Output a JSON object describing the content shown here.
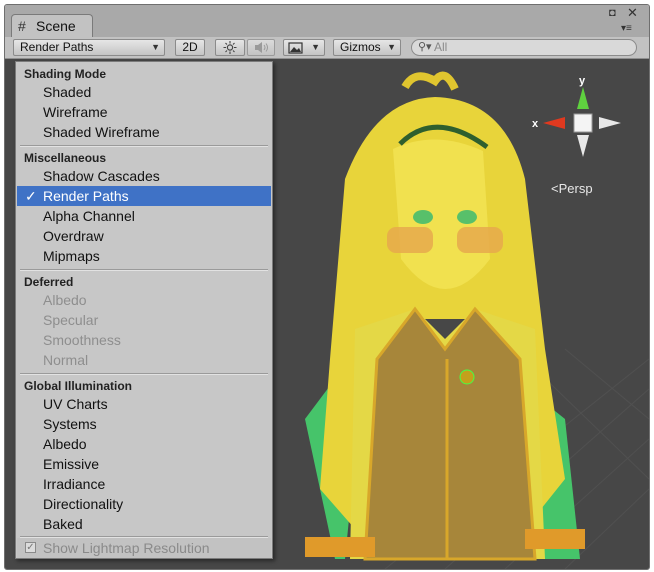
{
  "tab": {
    "icon": "scene-icon",
    "title": "Scene"
  },
  "toolbar": {
    "render_mode": "Render Paths",
    "mode_2d": "2D",
    "lighting_icon": "sun-icon",
    "audio_icon": "speaker-icon",
    "effects_icon": "image-icon",
    "gizmos": "Gizmos",
    "search_placeholder": "All"
  },
  "gizmo": {
    "y_label": "y",
    "x_label": "x",
    "projection": "Persp"
  },
  "menu": {
    "shading_header": "Shading Mode",
    "shading_items": [
      "Shaded",
      "Wireframe",
      "Shaded Wireframe"
    ],
    "misc_header": "Miscellaneous",
    "misc_items": [
      "Shadow Cascades",
      "Render Paths",
      "Alpha Channel",
      "Overdraw",
      "Mipmaps"
    ],
    "selected_check": "✓",
    "deferred_header": "Deferred",
    "deferred_items": [
      "Albedo",
      "Specular",
      "Smoothness",
      "Normal"
    ],
    "gi_header": "Global Illumination",
    "gi_items": [
      "UV Charts",
      "Systems",
      "Albedo",
      "Emissive",
      "Irradiance",
      "Directionality",
      "Baked"
    ],
    "lightmap_resolution": "Show Lightmap Resolution"
  },
  "colors": {
    "selection": "#3f72c6",
    "scene_bg": "#474747",
    "character_yellow": "#f2e23a",
    "character_green": "#4fcf73"
  }
}
